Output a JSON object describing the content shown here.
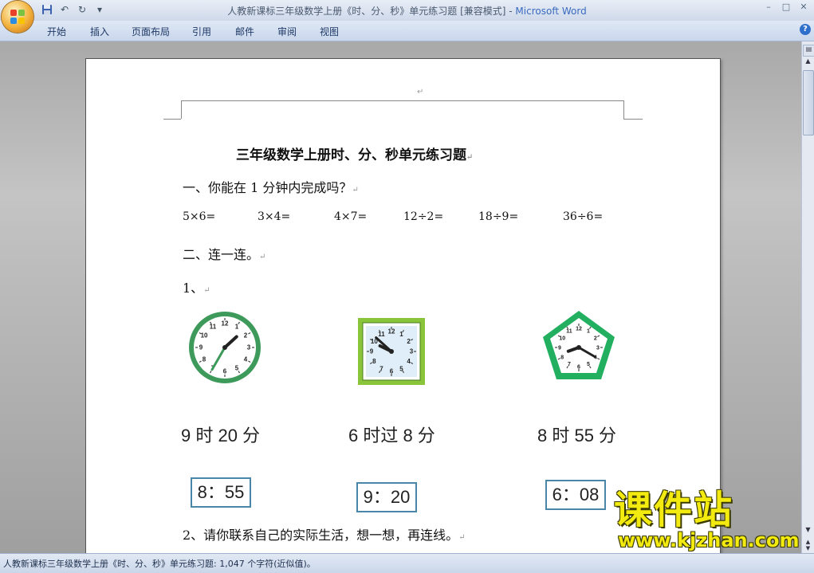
{
  "window": {
    "doc_title": "人教新课标三年级数学上册《时、分、秒》单元练习题 [兼容模式] - ",
    "app_name": "Microsoft Word",
    "controls": {
      "minimize": "–",
      "maximize": "□",
      "close": "✕"
    },
    "help": "?"
  },
  "quick_access": {
    "save_icon": "floppy-disk-icon",
    "undo_label": "↶",
    "redo_label": "↻",
    "customize_label": "▾"
  },
  "ribbon": {
    "tabs": [
      "开始",
      "插入",
      "页面布局",
      "引用",
      "邮件",
      "审阅",
      "视图"
    ]
  },
  "document": {
    "title": "三年级数学上册时、分、秒单元练习题",
    "section1": "一、你能在 1 分钟内完成吗？",
    "arithmetic": [
      "5×6=",
      "3×4=",
      "4×7=",
      "12÷2=",
      "18÷9=",
      "36÷6="
    ],
    "section2": "二、连一连。",
    "sub1": "1、",
    "time_labels": [
      "9 时 20 分",
      "6 时过 8 分",
      "8 时 55 分"
    ],
    "digital_times": [
      "8：55",
      "9：20",
      "6：08"
    ],
    "sub2": "2、请你联系自己的实际生活，想一想，再连线。",
    "paragraph_mark": "↵"
  },
  "clocks": [
    {
      "shape": "round",
      "hour": 1,
      "minute": 35,
      "rim_color": "#3d9a5a"
    },
    {
      "shape": "square",
      "hour": 9,
      "minute": 52,
      "rim_color": "#8ac43a"
    },
    {
      "shape": "pentagon",
      "hour": 8,
      "minute": 20,
      "rim_color": "#22b060"
    }
  ],
  "status": {
    "text": "人教新课标三年级数学上册《时、分、秒》单元练习题: 1,047 个字符(近似值)。"
  },
  "watermark": {
    "brand": "课件站",
    "url": "www.kjzhan.com"
  }
}
